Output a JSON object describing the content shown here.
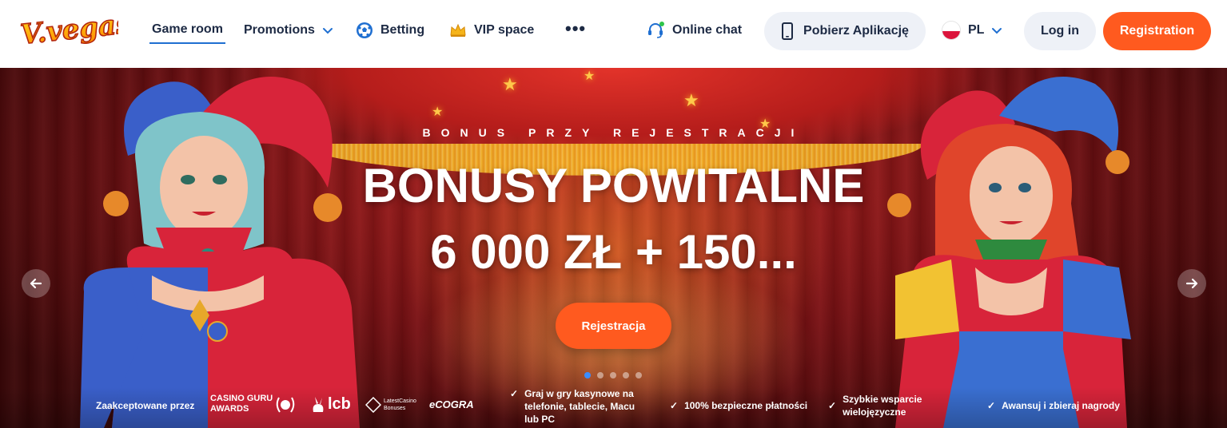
{
  "header": {
    "logo_text": "V.vegas",
    "nav": {
      "game_room": "Game room",
      "promotions": "Promotions",
      "betting": "Betting",
      "vip": "VIP space",
      "more": "•••"
    },
    "online_chat": "Online chat",
    "app_button": "Pobierz Aplikację",
    "language": "PL",
    "login": "Log in",
    "register": "Registration"
  },
  "hero": {
    "kicker": "BONUS PRZY REJESTRACJI",
    "title": "BONUSY POWITALNE",
    "subtitle": "6 000 ZŁ + 150...",
    "cta": "Rejestracja",
    "slides_total": 5,
    "active_slide": 1
  },
  "trust": {
    "accepted_label": "Zaakceptowane przez",
    "casino_guru_line1": "CASINO GURU",
    "casino_guru_line2": "AWARDS",
    "lcb": "lcb",
    "latest_line1": "LatestCasino",
    "latest_line2": "Bonuses",
    "ecogra": "eCOGRA",
    "features": [
      {
        "line1": "Graj w gry kasynowe na",
        "line2": "telefonie, tablecie, Macu",
        "line3": "lub PC"
      },
      {
        "line1": "100% bezpieczne płatności"
      },
      {
        "line1": "Szybkie wsparcie",
        "line2": "wielojęzyczne"
      },
      {
        "line1": "Awansuj i zbieraj nagrody"
      }
    ]
  },
  "colors": {
    "accent_orange": "#ff5a1f",
    "nav_text": "#1d2a44",
    "active_underline": "#1f6fd1",
    "pill_bg": "#eef1f7",
    "dot_active": "#3a8dff"
  },
  "icons": {
    "betting": "soccer-ball-icon",
    "vip": "crown-icon",
    "chat": "headset-icon",
    "app": "phone-icon"
  }
}
